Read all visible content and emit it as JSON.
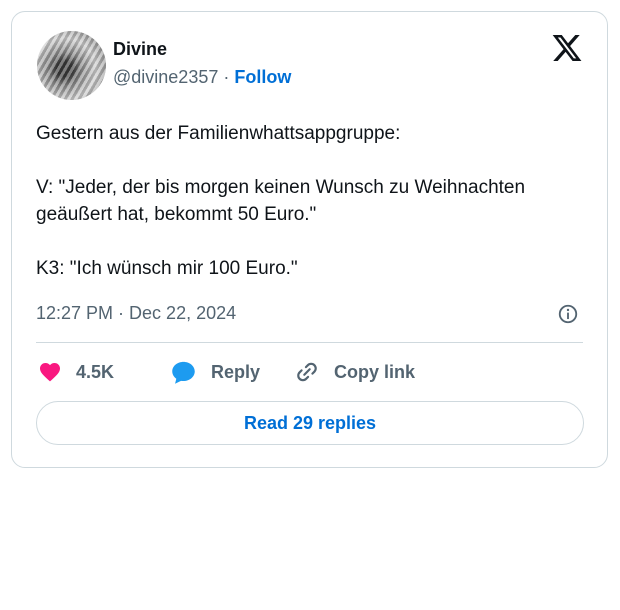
{
  "author": {
    "name": "Divine",
    "handle": "@divine2357",
    "separator": "·",
    "follow_label": "Follow"
  },
  "tweet": {
    "lines": [
      "Gestern aus der Familienwhattsappgruppe:",
      "V: \"Jeder, der bis morgen keinen Wunsch zu Weihnachten geäußert hat, bekommt 50 Euro.\"",
      "K3: \"Ich wünsch mir 100 Euro.\""
    ],
    "timestamp": "12:27 PM · Dec 22, 2024"
  },
  "actions": {
    "likes": "4.5K",
    "reply_label": "Reply",
    "copy_label": "Copy link"
  },
  "read_replies_label": "Read 29 replies",
  "icons": {
    "logo": "x-logo-icon",
    "info": "info-icon",
    "like": "heart-icon",
    "reply": "speech-bubble-icon",
    "copy": "link-icon"
  },
  "colors": {
    "accent": "#006fd6",
    "heart": "#f91880",
    "reply_bubble": "#1d9bf0",
    "muted": "#536471",
    "border": "#cfd9de"
  }
}
